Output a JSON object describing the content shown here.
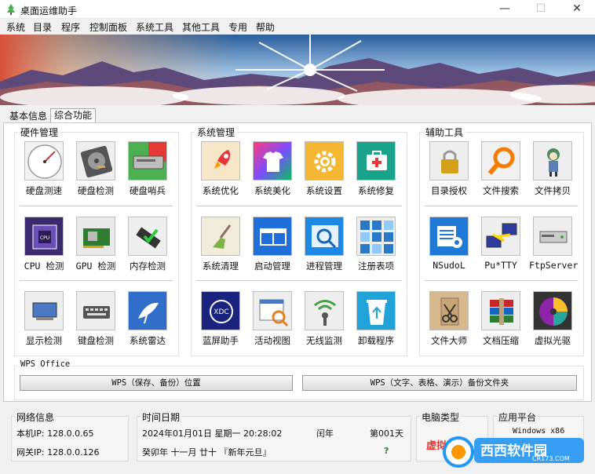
{
  "window": {
    "title": "桌面运维助手",
    "minimize": "—",
    "maximize": "☐",
    "close": "✕"
  },
  "menu": [
    "系统",
    "目录",
    "程序",
    "控制面板",
    "系统工具",
    "其他工具",
    "专用",
    "帮助"
  ],
  "tabs": [
    "基本信息",
    "综合功能"
  ],
  "groups": {
    "hardware": "硬件管理",
    "system": "系统管理",
    "aux": "辅助工具"
  },
  "tools": {
    "hardware": [
      "硬盘测速",
      "硬盘检测",
      "硬盘哨兵",
      "CPU 检测",
      "GPU 检测",
      "内存检测",
      "显示检测",
      "键盘检测",
      "系统雷达"
    ],
    "system": [
      "系统优化",
      "系统美化",
      "系统设置",
      "系统修复",
      "系统清理",
      "启动管理",
      "进程管理",
      "注册表项",
      "蓝屏助手",
      "活动视图",
      "无线监测",
      "卸载程序"
    ],
    "aux": [
      "目录授权",
      "文件搜索",
      "文件拷贝",
      "NSudoL",
      "Pu*TTY",
      "FtpServer",
      "文件大师",
      "文档压缩",
      "虚拟光驱"
    ]
  },
  "wps": {
    "title": "WPS Office",
    "btn1": "WPS（保存、备份）位置",
    "btn2": "WPS（文字、表格、演示）备份文件夹"
  },
  "status": {
    "network_title": "网络信息",
    "local_ip": "本机IP:  128.0.0.65",
    "gateway_ip": "网关IP:  128.0.0.126",
    "datetime_title": "时间日期",
    "date_line": "2024年01月01日 星期一 20:28:02",
    "leap": "闰年",
    "day_of_year": "第001天",
    "lunar_line": "癸卯年   十一月   廿十  『新年元旦』",
    "question": "?",
    "pc_type_title": "电脑类型",
    "pc_type_value": "虚拟主机",
    "platform_title": "应用平台",
    "platform_value": "Windows x86"
  },
  "watermark": {
    "text": "西西软件园",
    "sub": "CR173.COM"
  }
}
